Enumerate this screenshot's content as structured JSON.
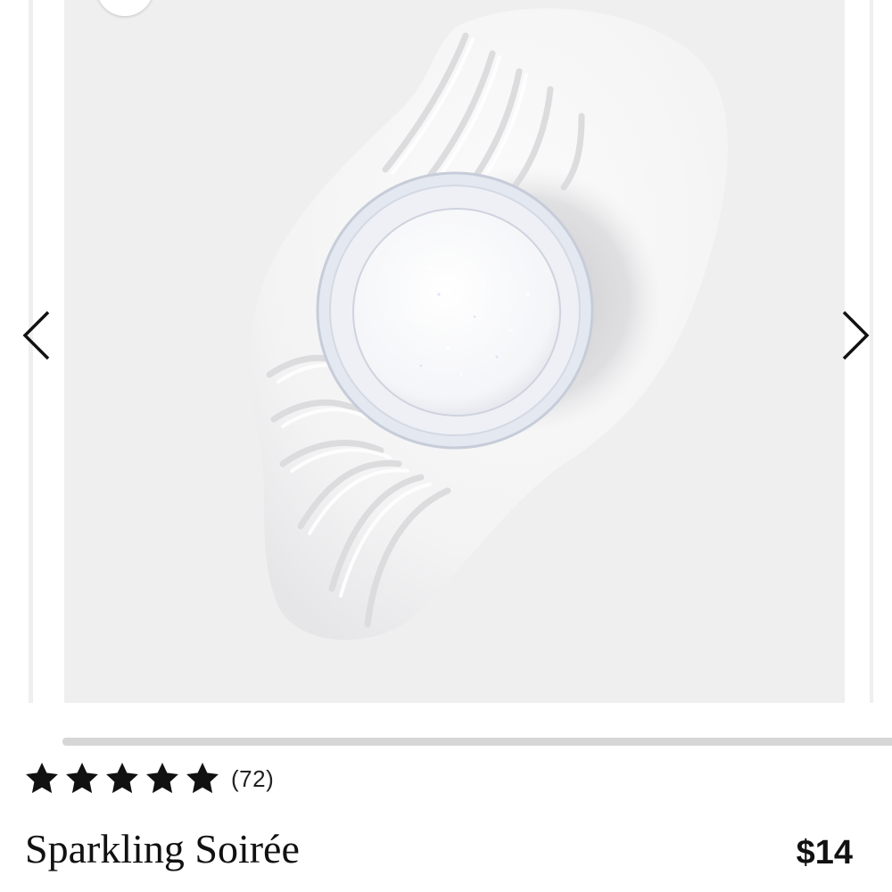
{
  "product": {
    "name": "Sparkling Soirée",
    "price": "$14",
    "rating": {
      "stars": 5,
      "filled": 5,
      "review_count_text": "(72)"
    }
  },
  "gallery": {
    "image_description_icon": "loose-glitter-jar-on-powder-swatch",
    "prev_icon": "chevron-left-icon",
    "next_icon": "chevron-right-icon",
    "scroll_progress": 1.0
  },
  "colors": {
    "background": "#ffffff",
    "image_bg": "#efeff0",
    "text": "#111111",
    "star": "#111111",
    "scrollbar": "#d6d6d6"
  }
}
